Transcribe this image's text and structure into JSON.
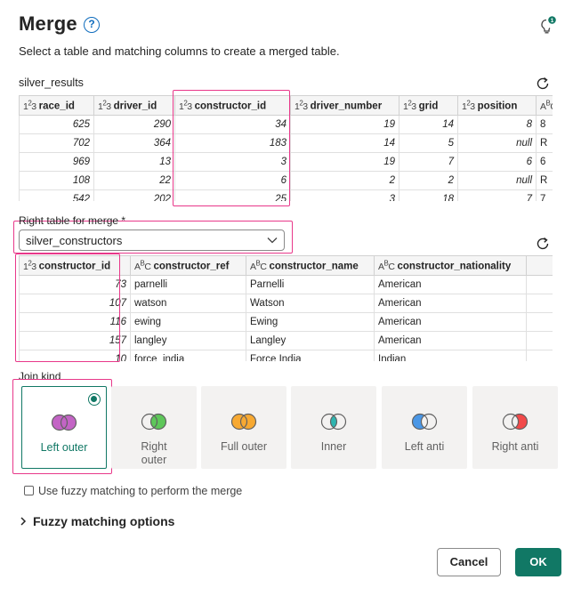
{
  "header": {
    "title": "Merge",
    "help_icon": "?",
    "subtitle": "Select a table and matching columns to create a merged table."
  },
  "left_table": {
    "name": "silver_results",
    "columns": [
      {
        "type": "123",
        "label": "race_id"
      },
      {
        "type": "123",
        "label": "driver_id"
      },
      {
        "type": "123",
        "label": "constructor_id"
      },
      {
        "type": "123",
        "label": "driver_number"
      },
      {
        "type": "123",
        "label": "grid"
      },
      {
        "type": "123",
        "label": "position"
      },
      {
        "type": "ABC",
        "label": ""
      }
    ],
    "rows": [
      [
        "625",
        "290",
        "34",
        "19",
        "14",
        "8",
        "8"
      ],
      [
        "702",
        "364",
        "183",
        "14",
        "5",
        "null",
        "R"
      ],
      [
        "969",
        "13",
        "3",
        "19",
        "7",
        "6",
        "6"
      ],
      [
        "108",
        "22",
        "6",
        "2",
        "2",
        "null",
        "R"
      ],
      [
        "542",
        "202",
        "25",
        "3",
        "18",
        "7",
        "7"
      ]
    ]
  },
  "right_table_select": {
    "label": "Right table for merge *",
    "value": "silver_constructors"
  },
  "right_table": {
    "columns": [
      {
        "type": "123",
        "label": "constructor_id"
      },
      {
        "type": "ABC",
        "label": "constructor_ref"
      },
      {
        "type": "ABC",
        "label": "constructor_name"
      },
      {
        "type": "ABC",
        "label": "constructor_nationality"
      },
      {
        "type": "",
        "label": ""
      }
    ],
    "rows": [
      [
        "73",
        "parnelli",
        "Parnelli",
        "American",
        ""
      ],
      [
        "107",
        "watson",
        "Watson",
        "American",
        ""
      ],
      [
        "116",
        "ewing",
        "Ewing",
        "American",
        ""
      ],
      [
        "157",
        "langley",
        "Langley",
        "American",
        ""
      ],
      [
        "10",
        "force_india",
        "Force India",
        "Indian",
        ""
      ]
    ]
  },
  "join_kind": {
    "label": "Join kind",
    "selected": "Left outer",
    "options": [
      {
        "label": "Left outer",
        "icon": "venn-left-outer-icon"
      },
      {
        "label": "Right outer",
        "icon": "venn-right-outer-icon"
      },
      {
        "label": "Full outer",
        "icon": "venn-full-outer-icon"
      },
      {
        "label": "Inner",
        "icon": "venn-inner-icon"
      },
      {
        "label": "Left anti",
        "icon": "venn-left-anti-icon"
      },
      {
        "label": "Right anti",
        "icon": "venn-right-anti-icon"
      }
    ]
  },
  "fuzzy": {
    "checkbox_label": "Use fuzzy matching to perform the merge",
    "checked": false,
    "options_label": "Fuzzy matching options"
  },
  "footer": {
    "cancel_label": "Cancel",
    "ok_label": "OK"
  },
  "colors": {
    "accent": "#117865",
    "highlight": "#e8388a",
    "purple": "#c364c5",
    "green": "#5ec75a",
    "orange": "#f7a932",
    "teal": "#2fb5b0",
    "blue": "#4a97e6",
    "red": "#f24a4a"
  }
}
